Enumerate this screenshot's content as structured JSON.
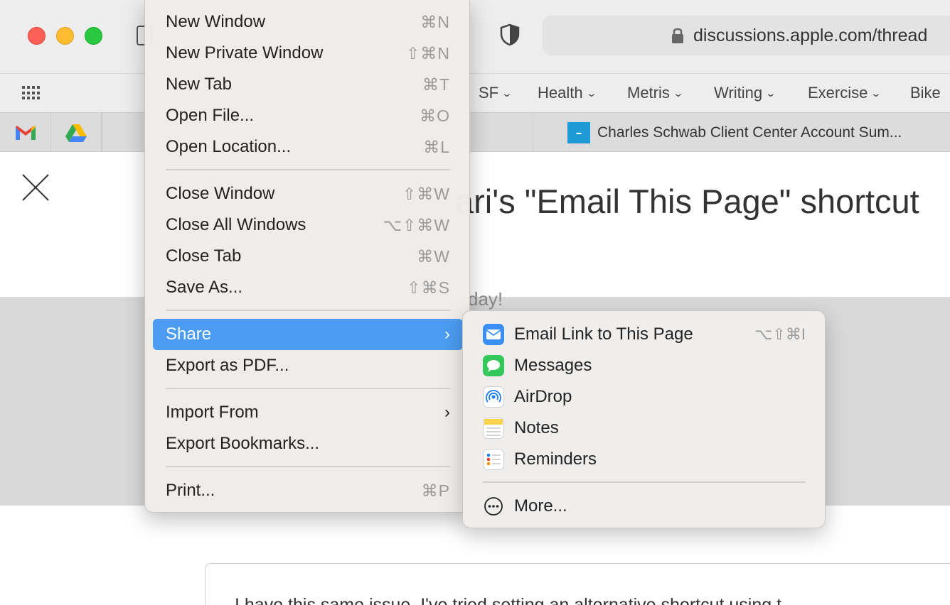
{
  "browser": {
    "address": "discussions.apple.com/thread",
    "bookmarks": [
      {
        "label": "SF"
      },
      {
        "label": "Health"
      },
      {
        "label": "Metris"
      },
      {
        "label": "Writing"
      },
      {
        "label": "Exercise"
      },
      {
        "label": "Bike"
      }
    ],
    "active_tab_title": "Charles Schwab Client Center Account Sum..."
  },
  "page": {
    "title_fragment": "ari's \"Email This Page\" shortcut",
    "faded_fragment": "day!",
    "post_text": "I have this same issue. I've tried setting an alternative shortcut using t"
  },
  "file_menu": {
    "items": [
      {
        "label": "New Window",
        "shortcut": "⌘N"
      },
      {
        "label": "New Private Window",
        "shortcut": "⇧⌘N"
      },
      {
        "label": "New Tab",
        "shortcut": "⌘T"
      },
      {
        "label": "Open File...",
        "shortcut": "⌘O"
      },
      {
        "label": "Open Location...",
        "shortcut": "⌘L"
      },
      {
        "label": "Close Window",
        "shortcut": "⇧⌘W"
      },
      {
        "label": "Close All Windows",
        "shortcut": "⌥⇧⌘W"
      },
      {
        "label": "Close Tab",
        "shortcut": "⌘W"
      },
      {
        "label": "Save As...",
        "shortcut": "⇧⌘S"
      },
      {
        "label": "Share",
        "arrow": "›"
      },
      {
        "label": "Export as PDF..."
      },
      {
        "label": "Import From",
        "arrow": "›"
      },
      {
        "label": "Export Bookmarks..."
      },
      {
        "label": "Print...",
        "shortcut": "⌘P"
      }
    ]
  },
  "share_menu": {
    "items": [
      {
        "label": "Email Link to This Page",
        "shortcut": "⌥⇧⌘I",
        "icon": "mail-icon"
      },
      {
        "label": "Messages",
        "icon": "messages-icon"
      },
      {
        "label": "AirDrop",
        "icon": "airdrop-icon"
      },
      {
        "label": "Notes",
        "icon": "notes-icon"
      },
      {
        "label": "Reminders",
        "icon": "reminders-icon"
      },
      {
        "label": "More...",
        "icon": "more-icon"
      }
    ]
  },
  "colors": {
    "menu_highlight": "#4b9cf2",
    "traffic_red": "#fe5f57",
    "traffic_yellow": "#febc2e",
    "traffic_green": "#28c840"
  }
}
